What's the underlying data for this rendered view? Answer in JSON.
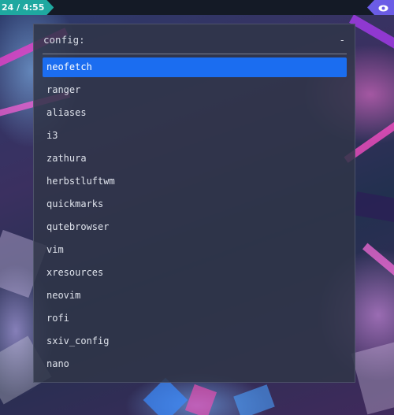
{
  "topbar": {
    "clock_text": "24 / 4:55",
    "clock_color": "#1fa8a0",
    "right_icon": "eye-icon",
    "right_icon_color": "#6b5ce6"
  },
  "rofi": {
    "prompt": "config:",
    "input_value": "",
    "suffix": "-",
    "selected_index": 0,
    "selected_color": "#1b6df0",
    "items": [
      {
        "label": "neofetch"
      },
      {
        "label": "ranger"
      },
      {
        "label": "aliases"
      },
      {
        "label": "i3"
      },
      {
        "label": "zathura"
      },
      {
        "label": "herbstluftwm"
      },
      {
        "label": "quickmarks"
      },
      {
        "label": "qutebrowser"
      },
      {
        "label": "vim"
      },
      {
        "label": "xresources"
      },
      {
        "label": "neovim"
      },
      {
        "label": "rofi"
      },
      {
        "label": "sxiv_config"
      },
      {
        "label": "nano"
      }
    ]
  }
}
